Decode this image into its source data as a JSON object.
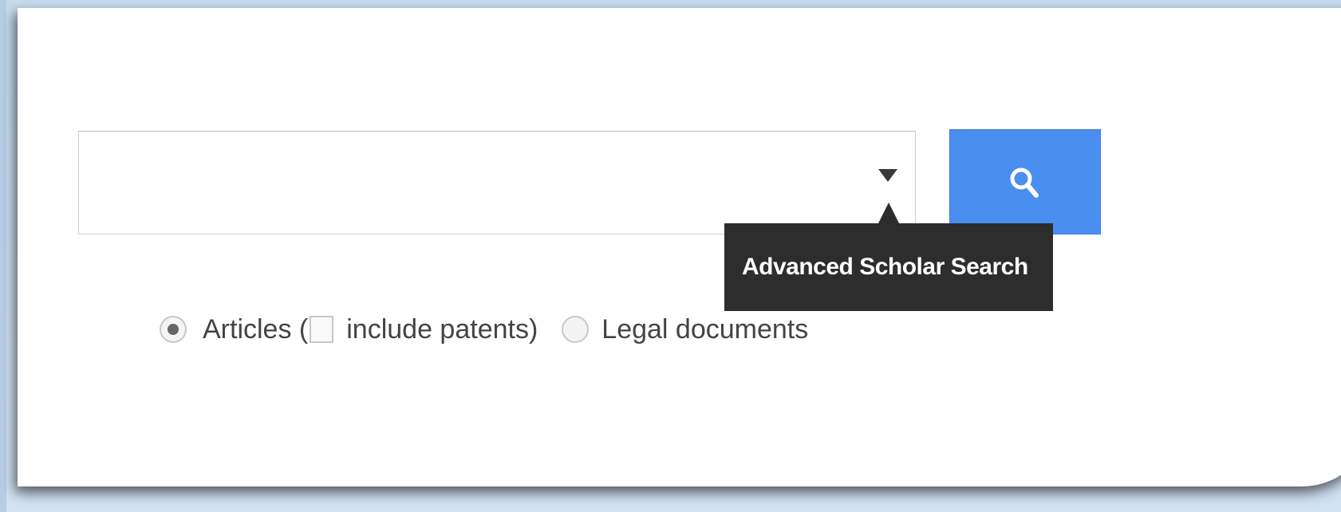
{
  "search": {
    "value": "",
    "placeholder": "",
    "dropdown_icon": "triangle-down-icon",
    "button_icon": "magnifier-icon",
    "button_color": "#4a8ef0"
  },
  "tooltip": {
    "text": "Advanced Scholar Search",
    "background": "#2d2d2d"
  },
  "options": {
    "articles_label": "Articles (",
    "articles_selected": true,
    "include_patents_label": "include patents)",
    "include_patents_checked": false,
    "legal_label": "Legal documents",
    "legal_selected": false
  }
}
